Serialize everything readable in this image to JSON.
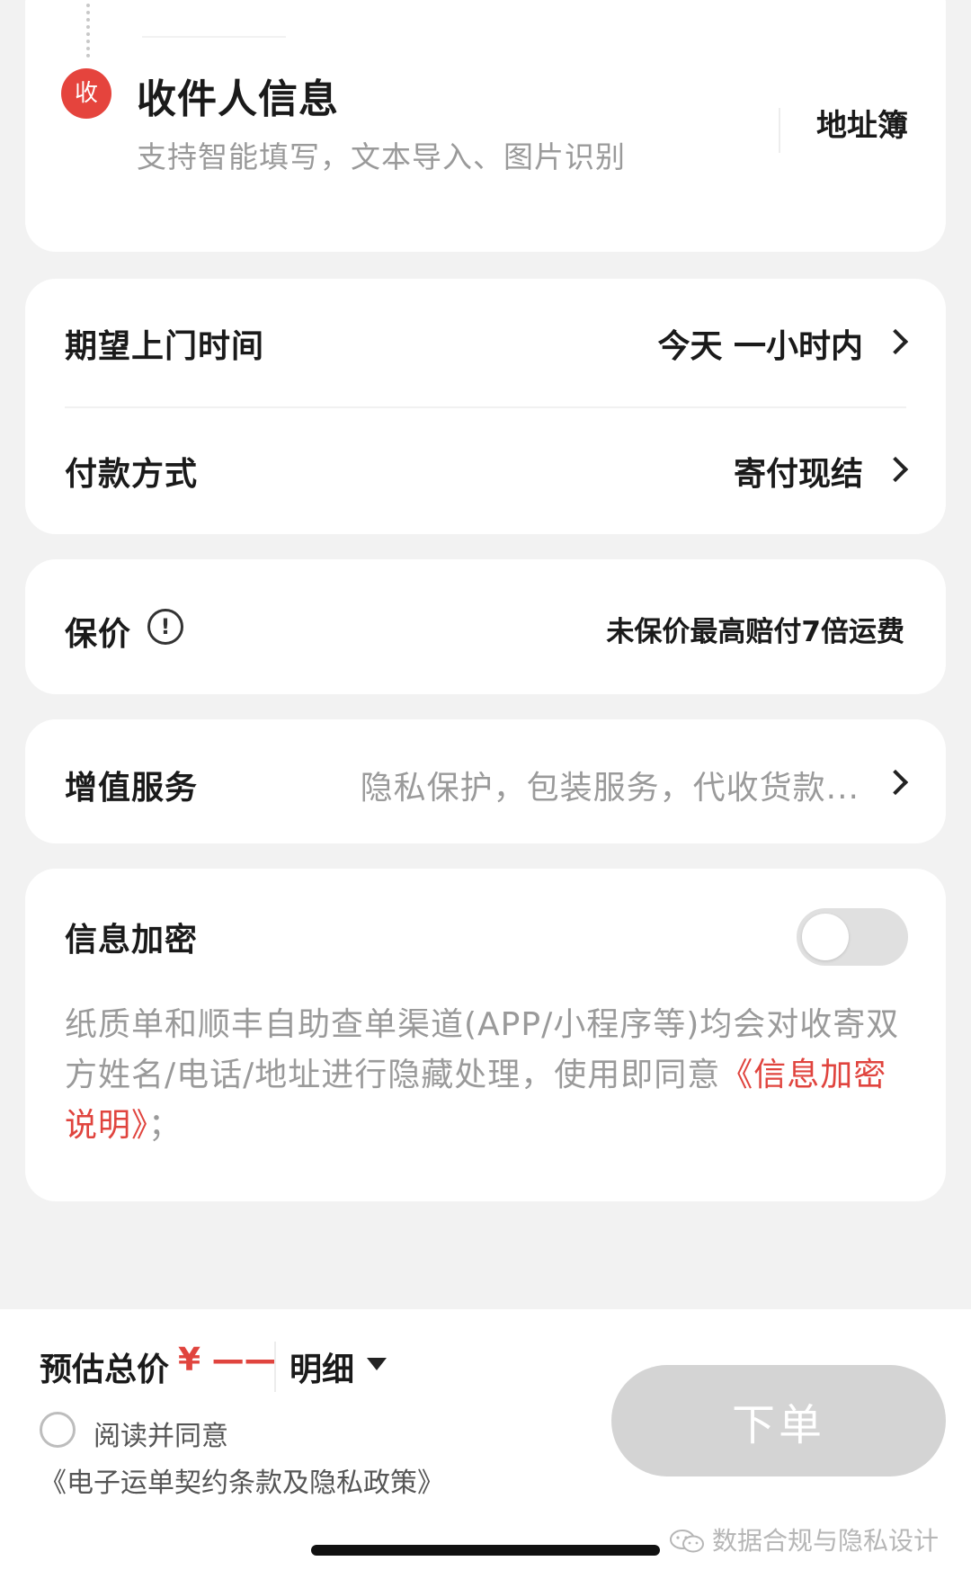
{
  "receiver": {
    "badge": "收",
    "title": "收件人信息",
    "subtitle": "支持智能填写，文本导入、图片识别",
    "address_book": "地址簿"
  },
  "pickup": {
    "label": "期望上门时间",
    "value": "今天 一小时内"
  },
  "payment": {
    "label": "付款方式",
    "value": "寄付现结"
  },
  "insurance": {
    "label": "保价",
    "info_glyph": "!",
    "value": "未保价最高赔付7倍运费"
  },
  "value_added": {
    "label": "增值服务",
    "value": "隐私保护，包装服务，代收货款..."
  },
  "encryption": {
    "label": "信息加密",
    "enabled": false,
    "description": "纸质单和顺丰自助查单渠道(APP/小程序等)均会对收寄双方姓名/电话/地址进行隐藏处理，使用即同意",
    "link_text": "《信息加密说明》",
    "suffix": "；"
  },
  "footer": {
    "estimate_label": "预估总价",
    "estimate_value": "¥ ——",
    "detail_label": "明细",
    "agree_label": "阅读并同意",
    "agreement_link": "《电子运单契约条款及隐私政策》",
    "order_button": "下单",
    "watermark": "数据合规与隐私设计"
  },
  "icons": {
    "info": "info-circle-icon",
    "chevron": "chevron-right-icon",
    "caret": "caret-down-icon",
    "wechat": "wechat-icon"
  },
  "colors": {
    "accent": "#e5443d",
    "link": "#e0443e",
    "disabled_button": "#d4d4d4",
    "background": "#f2f2f2"
  }
}
